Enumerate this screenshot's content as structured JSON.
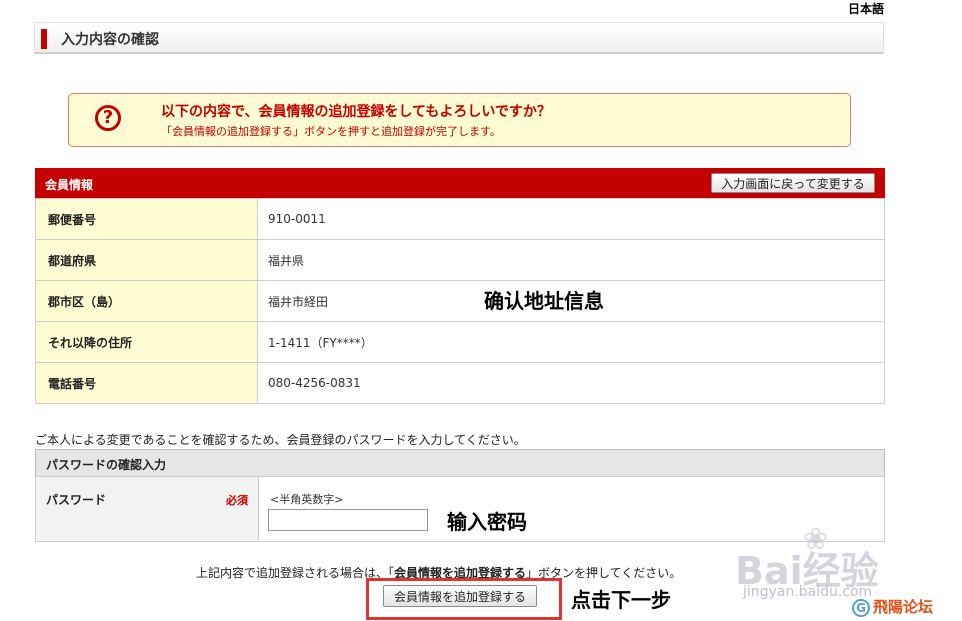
{
  "lang": "日本語",
  "page_title": "入力内容の確認",
  "alert": {
    "icon": "question-icon",
    "headline": "以下の内容で、会員情報の追加登録をしてもよろしいですか？",
    "sub": "「会員情報の追加登録する」ボタンを押すと追加登録が完了します。"
  },
  "member": {
    "section_title": "会員情報",
    "back_button": "入力画面に戻って変更する",
    "rows": [
      {
        "label": "郵便番号",
        "value": "910-0011"
      },
      {
        "label": "都道府県",
        "value": "福井県"
      },
      {
        "label": "郡市区（島）",
        "value": "福井市経田"
      },
      {
        "label": "それ以降の住所",
        "value": "1-1411（FY****）"
      },
      {
        "label": "電話番号",
        "value": "080-4256-0831"
      }
    ]
  },
  "password": {
    "intro": "ご本人による変更であることを確認するため、会員登録のパスワードを入力してください。",
    "section_title": "パスワードの確認入力",
    "label": "パスワード",
    "required": "必須",
    "hint": "<半角英数字>",
    "value": ""
  },
  "submit": {
    "note_before": "上記内容で追加登録される場合は、「",
    "note_bold": "会員情報を追加登録する",
    "note_after": "」ボタンを押してください。",
    "button": "会員情報を追加登録する"
  },
  "annotations": {
    "address": "确认地址信息",
    "password": "输入密码",
    "next": "点击下一步"
  },
  "watermark": {
    "brand": "Bai经验",
    "url": "jingyan.baidu.com",
    "forum": "飛陽论坛"
  },
  "colors": {
    "accent": "#c40000",
    "label_bg": "#fffbd3",
    "highlight": "#e23333"
  }
}
